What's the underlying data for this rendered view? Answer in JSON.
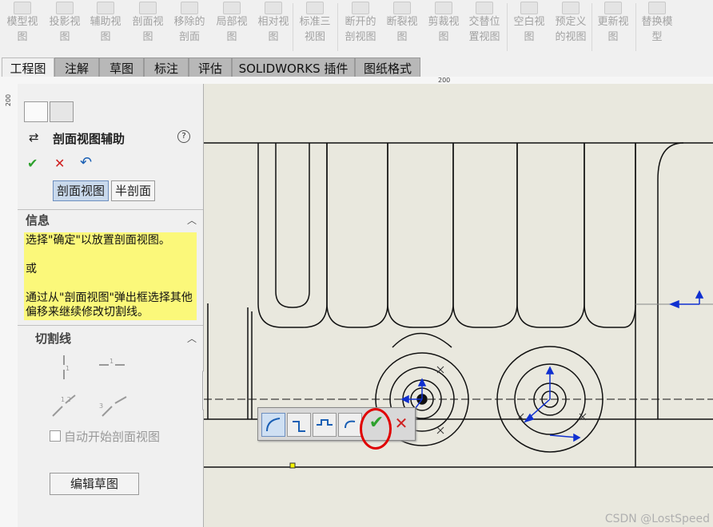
{
  "ribbon": {
    "items": [
      {
        "label": "模型视\n图"
      },
      {
        "label": "投影视\n图"
      },
      {
        "label": "辅助视\n图"
      },
      {
        "label": "剖面视\n图"
      },
      {
        "label": "移除的\n剖面"
      },
      {
        "label": "局部视\n图"
      },
      {
        "label": "相对视\n图"
      },
      {
        "label": "标准三\n视图"
      },
      {
        "label": "断开的\n剖视图"
      },
      {
        "label": "断裂视\n图"
      },
      {
        "label": "剪裁视\n图"
      },
      {
        "label": "交替位\n置视图"
      },
      {
        "label": "空白视\n图"
      },
      {
        "label": "预定义\n的视图"
      },
      {
        "label": "更新视\n图"
      },
      {
        "label": "替换模\n型"
      }
    ]
  },
  "tabs": [
    {
      "label": "工程图"
    },
    {
      "label": "注解"
    },
    {
      "label": "草图"
    },
    {
      "label": "标注"
    },
    {
      "label": "评估"
    },
    {
      "label": "SOLIDWORKS 插件"
    },
    {
      "label": "图纸格式"
    }
  ],
  "ruler": {
    "top_mark": "200",
    "left_mark": "200"
  },
  "pm": {
    "title": "剖面视图辅助",
    "help": "?",
    "ok": "✔",
    "cancel": "✕",
    "undo": "↶",
    "mode_section": "剖面视图",
    "mode_half": "半剖面",
    "info_header": "信息",
    "info_line1": "选择\"确定\"以放置剖面视图。",
    "info_line2": "或",
    "info_line3": "通过从\"剖面视图\"弹出框选择其他偏移来继续修改切割线。",
    "cut_header": "切割线",
    "auto_start": "自动开始剖面视图",
    "edit_sketch": "编辑草图"
  },
  "popup": {
    "ok": "✔",
    "cancel": "✕"
  },
  "watermark": "CSDN @LostSpeed"
}
